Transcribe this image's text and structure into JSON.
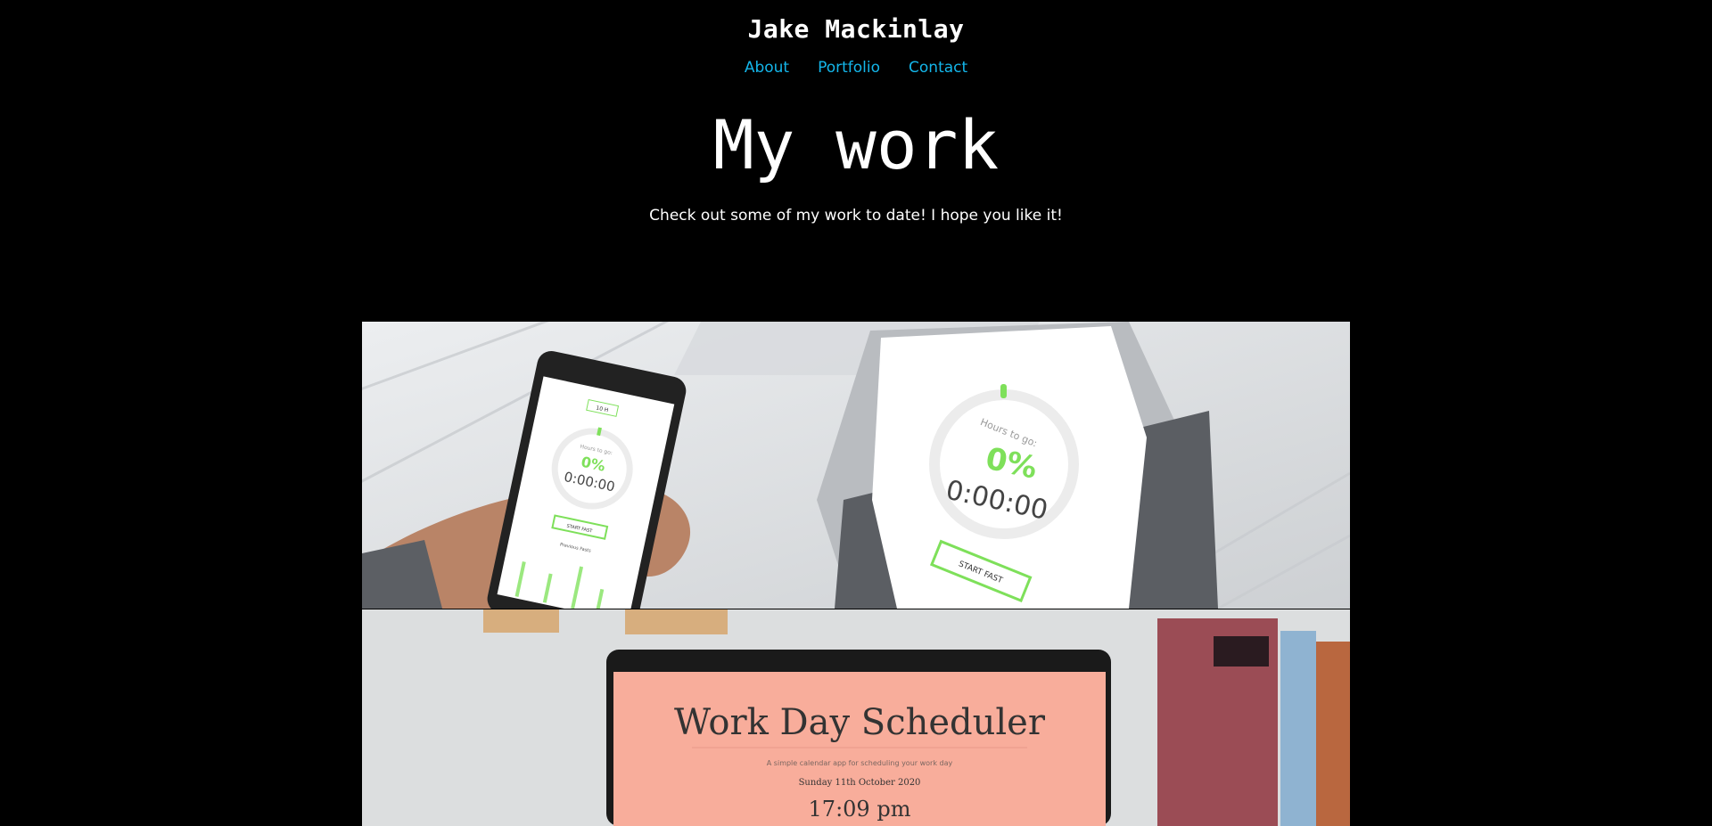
{
  "header": {
    "site_title": "Jake Mackinlay",
    "nav": [
      {
        "label": "About"
      },
      {
        "label": "Portfolio"
      },
      {
        "label": "Contact"
      }
    ]
  },
  "hero": {
    "title": "My work",
    "subtitle": "Check out some of my work to date! I hope you like it!"
  },
  "projects": [
    {
      "phone_screen": {
        "select": "10 H",
        "label": "Hours to go:",
        "percent": "0%",
        "time": "0:00:00",
        "button": "START FAST",
        "chart_label": "Previous Fasts"
      },
      "tablet_screen": {
        "label": "Hours to go:",
        "percent": "0%",
        "time": "0:00:00",
        "button": "START FAST"
      }
    },
    {
      "screen": {
        "title": "Work Day Scheduler",
        "tagline": "A simple calendar app for scheduling your work day",
        "date": "Sunday 11th October 2020",
        "time": "17:09 pm"
      }
    }
  ],
  "colors": {
    "background": "#000000",
    "link": "#14b6ea",
    "accent_green": "#7ee05a",
    "scheduler_screen": "#f8ad9b"
  }
}
